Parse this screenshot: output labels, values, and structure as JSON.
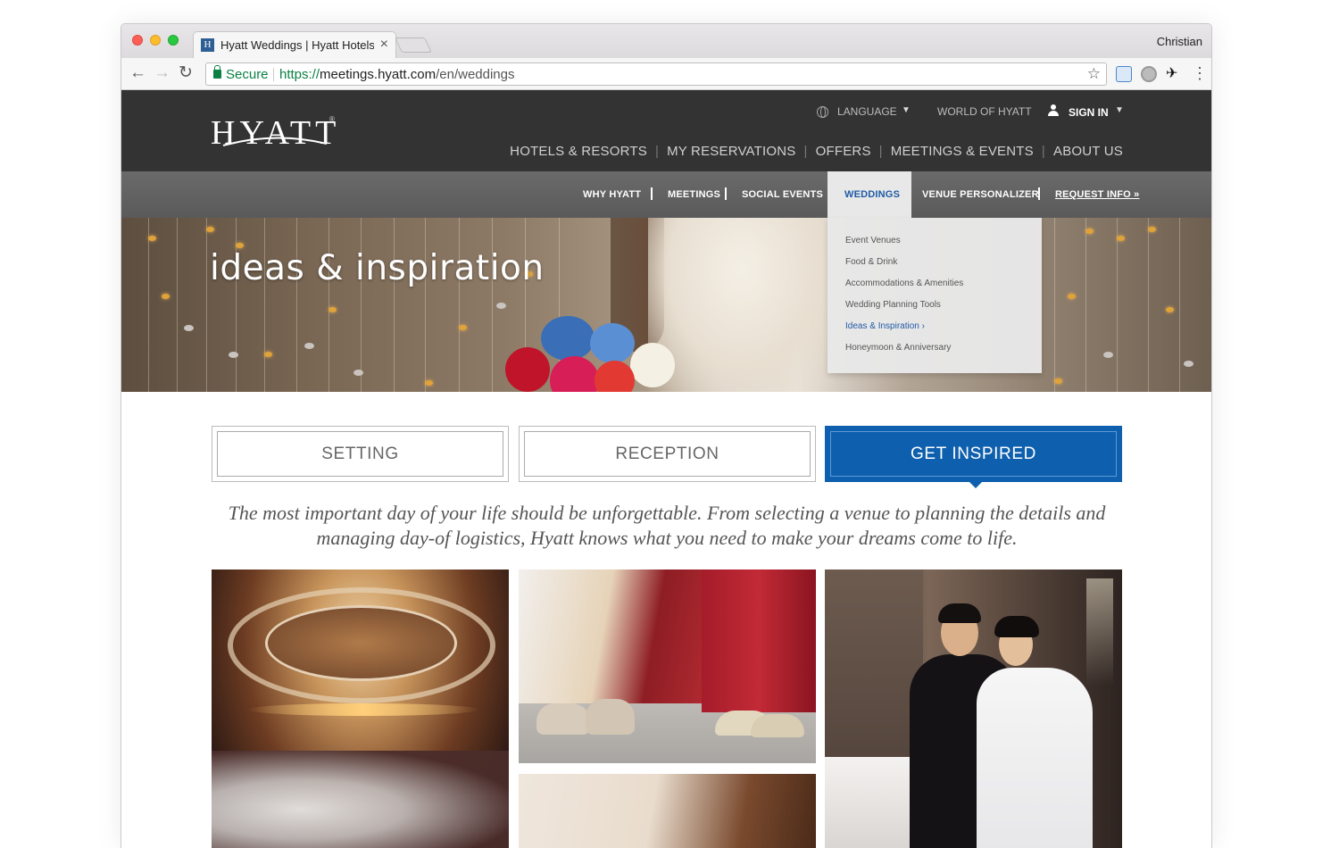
{
  "browser": {
    "tab_title": "Hyatt Weddings | Hyatt Hotels",
    "tab_favicon": "H",
    "profile_name": "Christian",
    "secure_label": "Secure",
    "url_scheme": "https://",
    "url_host": "meetings.hyatt.com",
    "url_path": "/en/weddings"
  },
  "header": {
    "logo_text": "HYATT",
    "logo_reg": "®",
    "language_label": "LANGUAGE",
    "world_label": "WORLD OF HYATT",
    "sign_in_label": "SIGN IN",
    "main_nav": [
      "HOTELS & RESORTS",
      "MY RESERVATIONS",
      "OFFERS",
      "MEETINGS & EVENTS",
      "ABOUT US"
    ]
  },
  "sub_nav": {
    "items": [
      "WHY HYATT",
      "MEETINGS",
      "SOCIAL EVENTS",
      "WEDDINGS",
      "VENUE PERSONALIZER",
      "REQUEST INFO »"
    ],
    "active": "WEDDINGS"
  },
  "dropdown": {
    "items": [
      "Event Venues",
      "Food & Drink",
      "Accommodations & Amenities",
      "Wedding Planning Tools",
      "Ideas & Inspiration ›",
      "Honeymoon & Anniversary"
    ],
    "active_index": 4
  },
  "hero": {
    "title": "ideas & inspiration"
  },
  "filters": {
    "tabs": [
      "SETTING",
      "RECEPTION",
      "GET INSPIRED"
    ],
    "active": "GET INSPIRED"
  },
  "intro_text": "The most important day of your life should be unforgettable. From selecting a venue to planning the details and managing day-of logistics, Hyatt knows what you need to make your dreams come to life.",
  "colors": {
    "header_bg": "#333333",
    "sub_nav_bg": "#5f5f5f",
    "accent_blue": "#0e5fad",
    "link_blue": "#1f5aa6"
  }
}
